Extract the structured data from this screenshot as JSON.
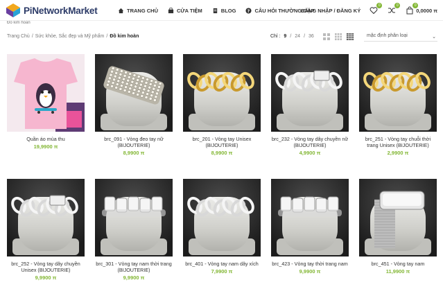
{
  "header": {
    "logo_text": "PiNetworkMarket",
    "nav": [
      {
        "label": "TRANG CHỦ",
        "icon": "home-icon"
      },
      {
        "label": "CỬA TIỆM",
        "icon": "bag-icon"
      },
      {
        "label": "BLOG",
        "icon": "document-icon"
      },
      {
        "label": "CÂU HỎI THƯỜNG GẶP",
        "icon": "question-icon"
      }
    ],
    "login_label": "ĐĂNG NHẬP / ĐĂNG KÝ",
    "wishlist_count": "0",
    "compare_count": "0",
    "cart_count": "0",
    "cart_total": "0,0000 π",
    "accent_color": "#83b735"
  },
  "breadcrumb_top": "Đồ kim hoàn",
  "toolbar": {
    "crumbs": [
      "Trang Chủ",
      "Sức khỏe, Sắc đẹp và Mỹ phẩm",
      "Đồ kim hoàn"
    ],
    "separator": "/",
    "show_label": "Chỉ :",
    "show_options": [
      "9",
      "24",
      "36"
    ],
    "sort_value": "mặc định phân loại"
  },
  "products": [
    {
      "name": "Quần áo mùa thu",
      "price": "19,9900",
      "currency": "π",
      "image": "tshirt"
    },
    {
      "name": "brc_091 - Vòng đeo tay nữ (BIJOUTERIE)",
      "price": "8,9900",
      "currency": "π",
      "image": "rhinestone"
    },
    {
      "name": "brc_201 - Vòng tay Unisex (BIJOUTERIE)",
      "price": "8,9900",
      "currency": "π",
      "image": "gold-chain"
    },
    {
      "name": "brc_232 - Vòng tay dây chuyền nữ (BIJOUTERIE)",
      "price": "4,9900",
      "currency": "π",
      "image": "silver-curb"
    },
    {
      "name": "brc_251 - Vòng tay chuỗi thời trang Unisex (BIJOUTERIE)",
      "price": "2,9900",
      "currency": "π",
      "image": "gold-curb"
    },
    {
      "name": "brc_252 - Vòng tay dây chuyền Unisex (BIJOUTERIE)",
      "price": "9,9900",
      "currency": "π",
      "image": "silver-curb"
    },
    {
      "name": "brc_301 - Vòng tay nam thời trang (BIJOUTERIE)",
      "price": "9,9900",
      "currency": "π",
      "image": "steel-link"
    },
    {
      "name": "brc_401 - Vòng tay nam dây xích",
      "price": "7,9900",
      "currency": "π",
      "image": "silver-chain"
    },
    {
      "name": "brc_423 - Vòng tay thời trang nam",
      "price": "9,9900",
      "currency": "π",
      "image": "steel-link"
    },
    {
      "name": "brc_451 - Vòng tay nam",
      "price": "11,9900",
      "currency": "π",
      "image": "mesh-plate"
    }
  ]
}
